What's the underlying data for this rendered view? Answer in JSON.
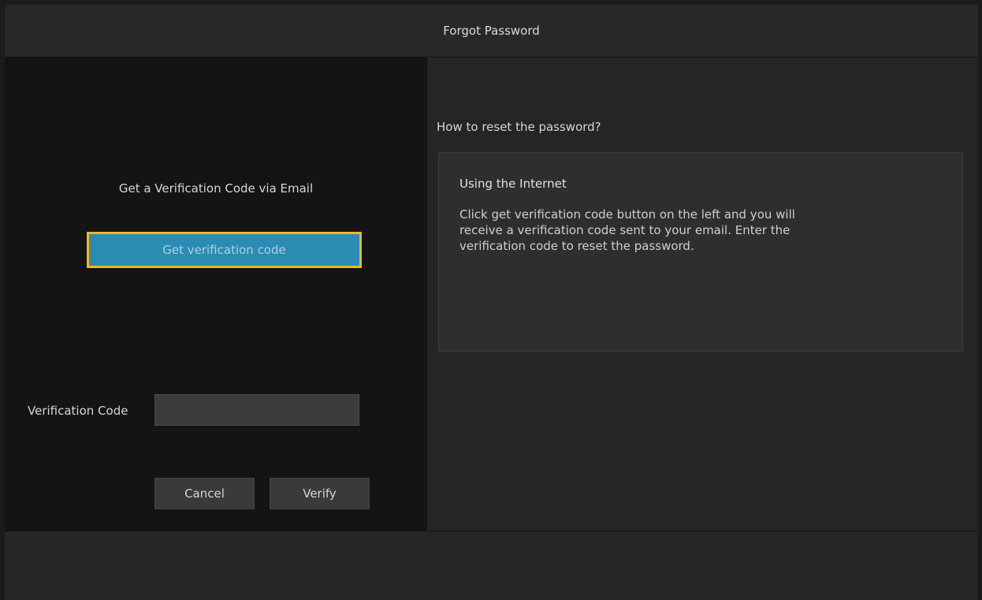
{
  "dialog": {
    "title": "Forgot Password"
  },
  "left": {
    "heading": "Get a Verification Code via Email",
    "get_code_label": "Get verification code",
    "code_label": "Verification Code",
    "code_value": "",
    "cancel_label": "Cancel",
    "verify_label": "Verify"
  },
  "right": {
    "question": "How to reset the password?",
    "info_title": "Using the Internet",
    "info_body": "Click get verification code button on the left and you will receive a verification code sent to your email. Enter the verification code to reset the password."
  },
  "colors": {
    "focus_border": "#f0b822",
    "primary_button": "#2a8cb2"
  }
}
